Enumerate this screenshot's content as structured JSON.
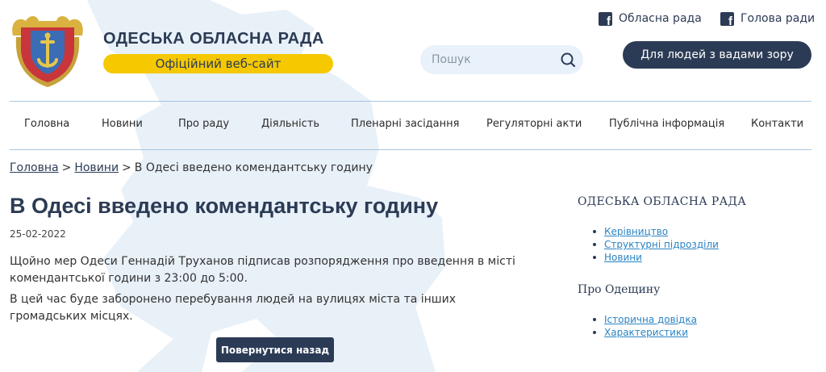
{
  "header": {
    "site_title": "ОДЕСЬКА ОБЛАСНА РАДА",
    "tagline": "Офіційний веб-сайт",
    "search_placeholder": "Пошук",
    "social": [
      {
        "label": "Обласна рада",
        "icon": "facebook-icon"
      },
      {
        "label": "Голова ради",
        "icon": "facebook-icon"
      }
    ],
    "vision_button": "Для людей з вадами зору"
  },
  "nav": {
    "items": [
      {
        "label": "Головна"
      },
      {
        "label": "Новини"
      },
      {
        "label": "Про раду"
      },
      {
        "label": "Діяльність"
      },
      {
        "label": "Пленарні засідання"
      },
      {
        "label": "Регуляторні акти"
      },
      {
        "label": "Публічна інформація"
      },
      {
        "label": "Контакти"
      }
    ]
  },
  "breadcrumb": {
    "home": "Головна",
    "separator": ">",
    "news": "Новини",
    "current": "В Одесі введено комендантську годину"
  },
  "article": {
    "title": "В Одесі введено комендантську годину",
    "date": "25-02-2022",
    "paragraphs": [
      "Щойно мер Одеси Геннадій Труханов підписав розпорядження про введення в місті комендантської години з 23:00 до 5:00.",
      "В цей час буде заборонено перебування людей на вулицях міста та інших громадських місцях."
    ],
    "back_button": "Повернутися назад"
  },
  "sidebar": {
    "sections": [
      {
        "heading": "ОДЕСЬКА ОБЛАСНА РАДА",
        "links": [
          "Керівництво",
          "Структурні підрозділи",
          "Новини"
        ]
      },
      {
        "heading": "Про Одещину",
        "links": [
          "Історична довідка",
          "Характеристики"
        ]
      }
    ]
  },
  "colors": {
    "brand_navy": "#2c3b55",
    "accent_yellow": "#f5c800",
    "link_blue": "#2a84c4",
    "divider": "#a9c6df",
    "search_bg": "#e9f1fa",
    "map_bg": "#e8f0f8"
  }
}
